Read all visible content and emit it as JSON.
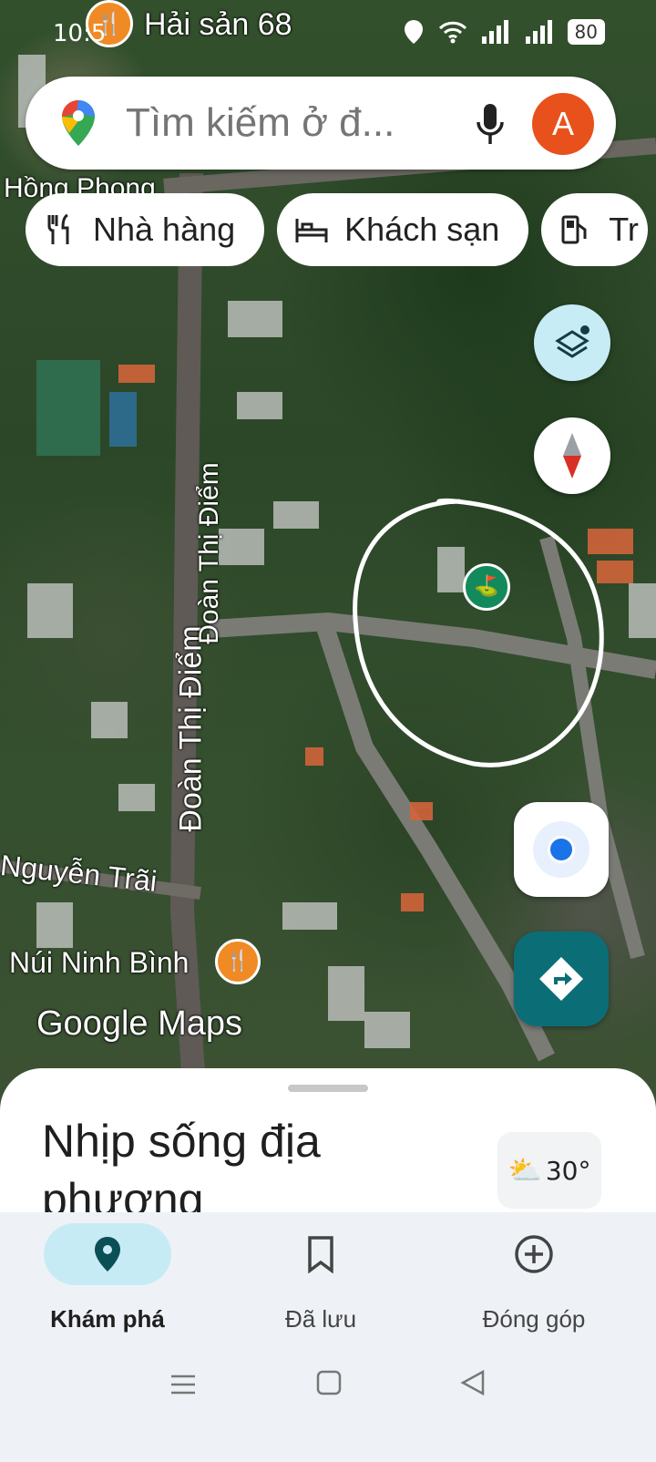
{
  "status_bar": {
    "time": "10:5",
    "battery": "80"
  },
  "search": {
    "placeholder": "Tìm kiếm ở đ...",
    "avatar_letter": "A"
  },
  "chips": [
    {
      "label": "Nhà hàng",
      "icon": "fork-knife-icon"
    },
    {
      "label": "Khách sạn",
      "icon": "bed-icon"
    },
    {
      "label": "Tr",
      "icon": "fuel-icon"
    }
  ],
  "map_labels": {
    "poi_top": "Hải sản 68",
    "road_hong_phong": "Hồng Phong",
    "road_doan_thi_diem_1": "Đoàn Thị Điểm",
    "road_doan_thi_diem_2": "Đoàn Thị Điểm",
    "road_nguyen_trai": "Nguyễn Trãi",
    "poi_nui_ninh_binh": "Núi Ninh Bình",
    "watermark": "Google Maps"
  },
  "sheet": {
    "title": "Nhịp sống địa phương",
    "temperature": "30°"
  },
  "bottom_nav": [
    {
      "label": "Khám phá",
      "icon": "explore-pin-icon",
      "selected": true
    },
    {
      "label": "Đã lưu",
      "icon": "bookmark-icon",
      "selected": false
    },
    {
      "label": "Đóng góp",
      "icon": "add-circle-icon",
      "selected": false
    }
  ],
  "colors": {
    "accent": "#0b6e77",
    "selected_tab": "#c7ebf5",
    "avatar": "#e8511b",
    "poi_orange": "#f08a24",
    "poi_green": "#138a5b"
  }
}
